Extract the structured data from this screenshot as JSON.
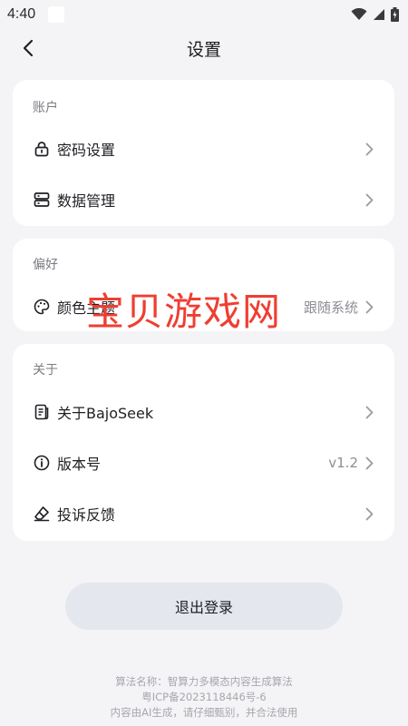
{
  "status_bar": {
    "time": "4:40"
  },
  "header": {
    "title": "设置"
  },
  "sections": {
    "account": {
      "title": "账户",
      "items": [
        {
          "label": "密码设置",
          "icon": "lock-icon"
        },
        {
          "label": "数据管理",
          "icon": "database-icon"
        }
      ]
    },
    "preferences": {
      "title": "偏好",
      "items": [
        {
          "label": "颜色主题",
          "icon": "palette-icon",
          "value": "跟随系统"
        }
      ]
    },
    "about": {
      "title": "关于",
      "items": [
        {
          "label": "关于BajoSeek",
          "icon": "document-icon"
        },
        {
          "label": "版本号",
          "icon": "info-icon",
          "value": "v1.2"
        },
        {
          "label": "投诉反馈",
          "icon": "eraser-icon"
        }
      ]
    }
  },
  "watermark": "宝贝游戏网",
  "logout_label": "退出登录",
  "footer": {
    "line1": "算法名称：智算力多模态内容生成算法",
    "line2": "粤ICP备2023118446号-6",
    "line3": "内容由AI生成，请仔细甄别，并合法使用"
  },
  "colors": {
    "background": "#f4f4f6",
    "card": "#ffffff",
    "logout_bg": "#e5e7ee",
    "watermark": "#ef3e31"
  }
}
